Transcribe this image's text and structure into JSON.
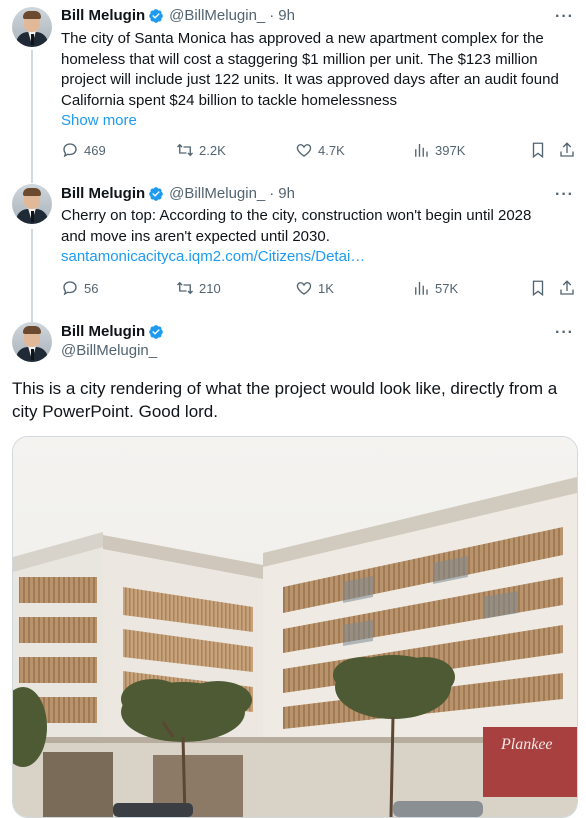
{
  "tweets": [
    {
      "name": "Bill Melugin",
      "handle": "@BillMelugin_",
      "time": "9h",
      "text_lines": [
        "The city of Santa Monica has approved a new apartment complex for the",
        "homeless that will cost a staggering $1 million per unit. The $123 million",
        "project will include just 122 units. It was approved days after an audit found",
        "California spent $24 billion to tackle homelessness"
      ],
      "show_more": "Show more",
      "replies": "469",
      "reposts": "2.2K",
      "likes": "4.7K",
      "views": "397K"
    },
    {
      "name": "Bill Melugin",
      "handle": "@BillMelugin_",
      "time": "9h",
      "text_lines": [
        "Cherry on top: According to the city, construction won't begin until 2028",
        "and move ins aren't expected until 2030."
      ],
      "link": "santamonicacityca.iqm2.com/Citizens/Detai…",
      "replies": "56",
      "reposts": "210",
      "likes": "1K",
      "views": "57K"
    }
  ],
  "main": {
    "name": "Bill Melugin",
    "handle": "@BillMelugin_",
    "text_lines": [
      "This is a city rendering of what the project would look like, directly from a",
      "city PowerPoint. Good lord."
    ],
    "image_sign": "Plankee"
  },
  "colors": {
    "verified": "#1d9bf0",
    "muted": "#536471",
    "link": "#1d9bf0"
  }
}
